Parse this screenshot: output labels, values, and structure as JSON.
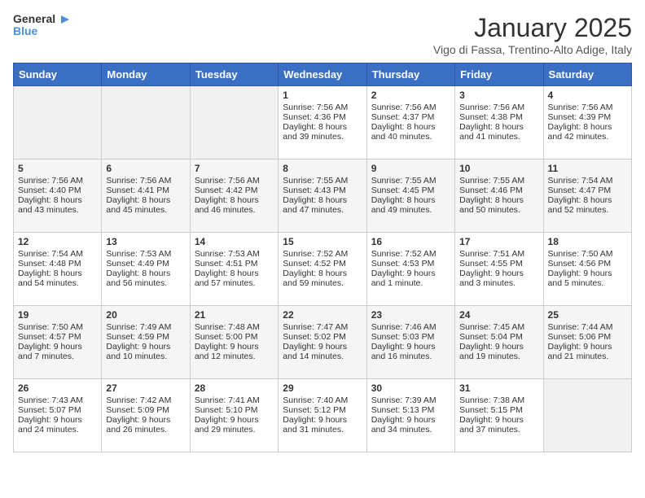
{
  "logo": {
    "line1": "General",
    "line2": "Blue"
  },
  "title": "January 2025",
  "subtitle": "Vigo di Fassa, Trentino-Alto Adige, Italy",
  "days_of_week": [
    "Sunday",
    "Monday",
    "Tuesday",
    "Wednesday",
    "Thursday",
    "Friday",
    "Saturday"
  ],
  "weeks": [
    [
      {
        "day": "",
        "empty": true
      },
      {
        "day": "",
        "empty": true
      },
      {
        "day": "",
        "empty": true
      },
      {
        "day": "1",
        "sunrise": "Sunrise: 7:56 AM",
        "sunset": "Sunset: 4:36 PM",
        "daylight": "Daylight: 8 hours and 39 minutes."
      },
      {
        "day": "2",
        "sunrise": "Sunrise: 7:56 AM",
        "sunset": "Sunset: 4:37 PM",
        "daylight": "Daylight: 8 hours and 40 minutes."
      },
      {
        "day": "3",
        "sunrise": "Sunrise: 7:56 AM",
        "sunset": "Sunset: 4:38 PM",
        "daylight": "Daylight: 8 hours and 41 minutes."
      },
      {
        "day": "4",
        "sunrise": "Sunrise: 7:56 AM",
        "sunset": "Sunset: 4:39 PM",
        "daylight": "Daylight: 8 hours and 42 minutes."
      }
    ],
    [
      {
        "day": "5",
        "sunrise": "Sunrise: 7:56 AM",
        "sunset": "Sunset: 4:40 PM",
        "daylight": "Daylight: 8 hours and 43 minutes."
      },
      {
        "day": "6",
        "sunrise": "Sunrise: 7:56 AM",
        "sunset": "Sunset: 4:41 PM",
        "daylight": "Daylight: 8 hours and 45 minutes."
      },
      {
        "day": "7",
        "sunrise": "Sunrise: 7:56 AM",
        "sunset": "Sunset: 4:42 PM",
        "daylight": "Daylight: 8 hours and 46 minutes."
      },
      {
        "day": "8",
        "sunrise": "Sunrise: 7:55 AM",
        "sunset": "Sunset: 4:43 PM",
        "daylight": "Daylight: 8 hours and 47 minutes."
      },
      {
        "day": "9",
        "sunrise": "Sunrise: 7:55 AM",
        "sunset": "Sunset: 4:45 PM",
        "daylight": "Daylight: 8 hours and 49 minutes."
      },
      {
        "day": "10",
        "sunrise": "Sunrise: 7:55 AM",
        "sunset": "Sunset: 4:46 PM",
        "daylight": "Daylight: 8 hours and 50 minutes."
      },
      {
        "day": "11",
        "sunrise": "Sunrise: 7:54 AM",
        "sunset": "Sunset: 4:47 PM",
        "daylight": "Daylight: 8 hours and 52 minutes."
      }
    ],
    [
      {
        "day": "12",
        "sunrise": "Sunrise: 7:54 AM",
        "sunset": "Sunset: 4:48 PM",
        "daylight": "Daylight: 8 hours and 54 minutes."
      },
      {
        "day": "13",
        "sunrise": "Sunrise: 7:53 AM",
        "sunset": "Sunset: 4:49 PM",
        "daylight": "Daylight: 8 hours and 56 minutes."
      },
      {
        "day": "14",
        "sunrise": "Sunrise: 7:53 AM",
        "sunset": "Sunset: 4:51 PM",
        "daylight": "Daylight: 8 hours and 57 minutes."
      },
      {
        "day": "15",
        "sunrise": "Sunrise: 7:52 AM",
        "sunset": "Sunset: 4:52 PM",
        "daylight": "Daylight: 8 hours and 59 minutes."
      },
      {
        "day": "16",
        "sunrise": "Sunrise: 7:52 AM",
        "sunset": "Sunset: 4:53 PM",
        "daylight": "Daylight: 9 hours and 1 minute."
      },
      {
        "day": "17",
        "sunrise": "Sunrise: 7:51 AM",
        "sunset": "Sunset: 4:55 PM",
        "daylight": "Daylight: 9 hours and 3 minutes."
      },
      {
        "day": "18",
        "sunrise": "Sunrise: 7:50 AM",
        "sunset": "Sunset: 4:56 PM",
        "daylight": "Daylight: 9 hours and 5 minutes."
      }
    ],
    [
      {
        "day": "19",
        "sunrise": "Sunrise: 7:50 AM",
        "sunset": "Sunset: 4:57 PM",
        "daylight": "Daylight: 9 hours and 7 minutes."
      },
      {
        "day": "20",
        "sunrise": "Sunrise: 7:49 AM",
        "sunset": "Sunset: 4:59 PM",
        "daylight": "Daylight: 9 hours and 10 minutes."
      },
      {
        "day": "21",
        "sunrise": "Sunrise: 7:48 AM",
        "sunset": "Sunset: 5:00 PM",
        "daylight": "Daylight: 9 hours and 12 minutes."
      },
      {
        "day": "22",
        "sunrise": "Sunrise: 7:47 AM",
        "sunset": "Sunset: 5:02 PM",
        "daylight": "Daylight: 9 hours and 14 minutes."
      },
      {
        "day": "23",
        "sunrise": "Sunrise: 7:46 AM",
        "sunset": "Sunset: 5:03 PM",
        "daylight": "Daylight: 9 hours and 16 minutes."
      },
      {
        "day": "24",
        "sunrise": "Sunrise: 7:45 AM",
        "sunset": "Sunset: 5:04 PM",
        "daylight": "Daylight: 9 hours and 19 minutes."
      },
      {
        "day": "25",
        "sunrise": "Sunrise: 7:44 AM",
        "sunset": "Sunset: 5:06 PM",
        "daylight": "Daylight: 9 hours and 21 minutes."
      }
    ],
    [
      {
        "day": "26",
        "sunrise": "Sunrise: 7:43 AM",
        "sunset": "Sunset: 5:07 PM",
        "daylight": "Daylight: 9 hours and 24 minutes."
      },
      {
        "day": "27",
        "sunrise": "Sunrise: 7:42 AM",
        "sunset": "Sunset: 5:09 PM",
        "daylight": "Daylight: 9 hours and 26 minutes."
      },
      {
        "day": "28",
        "sunrise": "Sunrise: 7:41 AM",
        "sunset": "Sunset: 5:10 PM",
        "daylight": "Daylight: 9 hours and 29 minutes."
      },
      {
        "day": "29",
        "sunrise": "Sunrise: 7:40 AM",
        "sunset": "Sunset: 5:12 PM",
        "daylight": "Daylight: 9 hours and 31 minutes."
      },
      {
        "day": "30",
        "sunrise": "Sunrise: 7:39 AM",
        "sunset": "Sunset: 5:13 PM",
        "daylight": "Daylight: 9 hours and 34 minutes."
      },
      {
        "day": "31",
        "sunrise": "Sunrise: 7:38 AM",
        "sunset": "Sunset: 5:15 PM",
        "daylight": "Daylight: 9 hours and 37 minutes."
      },
      {
        "day": "",
        "empty": true
      }
    ]
  ]
}
